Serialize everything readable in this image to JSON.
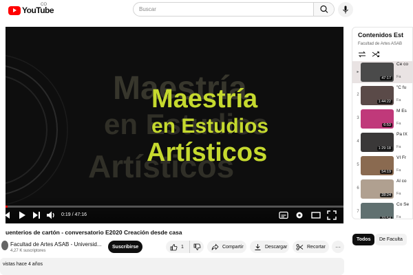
{
  "header": {
    "logo_text": "YouTube",
    "country_code": "CO",
    "search_placeholder": "Buscar"
  },
  "player": {
    "slide_line1": "Maestría",
    "slide_line2": "en Estudios",
    "slide_line3": "Artísticos",
    "ghost_line1": "Maestría",
    "ghost_line2": "en Estudios",
    "ghost_line3": "Artísticos",
    "time": "0:19 / 47:16",
    "progress_fraction": 0.0067
  },
  "video": {
    "title": "uenterios de cartón - conversatorio E2020 Creación desde casa",
    "channel": "Facultad de Artes ASAB - Universid...",
    "subscribers": "4,27 K suscriptores",
    "subscribe_label": "Suscribirse",
    "likes": "1",
    "share_label": "Compartir",
    "download_label": "Descargar",
    "clip_label": "Recortar",
    "more_label": "···",
    "description_meta": "vistas  hace 4 años"
  },
  "playlist": {
    "title": "Contenidos Est",
    "channel": "Facultad de Artes ASAB",
    "items": [
      {
        "index": "▸",
        "title": "Ce co",
        "channel": "Fa",
        "duration": "47:17",
        "active": true,
        "thumb": "#4a4a4a"
      },
      {
        "index": "2",
        "title": "\"C fu",
        "channel": "Fa",
        "duration": "1:44:22",
        "active": false,
        "thumb": "#5a4a48"
      },
      {
        "index": "3",
        "title": "M Es",
        "channel": "Fa",
        "duration": "6:53",
        "active": false,
        "thumb": "#c0397a"
      },
      {
        "index": "4",
        "title": "Pa IX",
        "channel": "Fa",
        "duration": "1:29:18",
        "active": false,
        "thumb": "#3a3838"
      },
      {
        "index": "5",
        "title": "VI Fr",
        "channel": "Fa",
        "duration": "54:19",
        "active": false,
        "thumb": "#8a6a50"
      },
      {
        "index": "6",
        "title": "Al co",
        "channel": "Fa",
        "duration": "28:24",
        "active": false,
        "thumb": "#b0a090"
      },
      {
        "index": "7",
        "title": "Co Se",
        "channel": "Fa",
        "duration": "33:54",
        "active": false,
        "thumb": "#607070"
      }
    ]
  },
  "chips": {
    "all": "Todos",
    "faculty": "De Faculta"
  }
}
